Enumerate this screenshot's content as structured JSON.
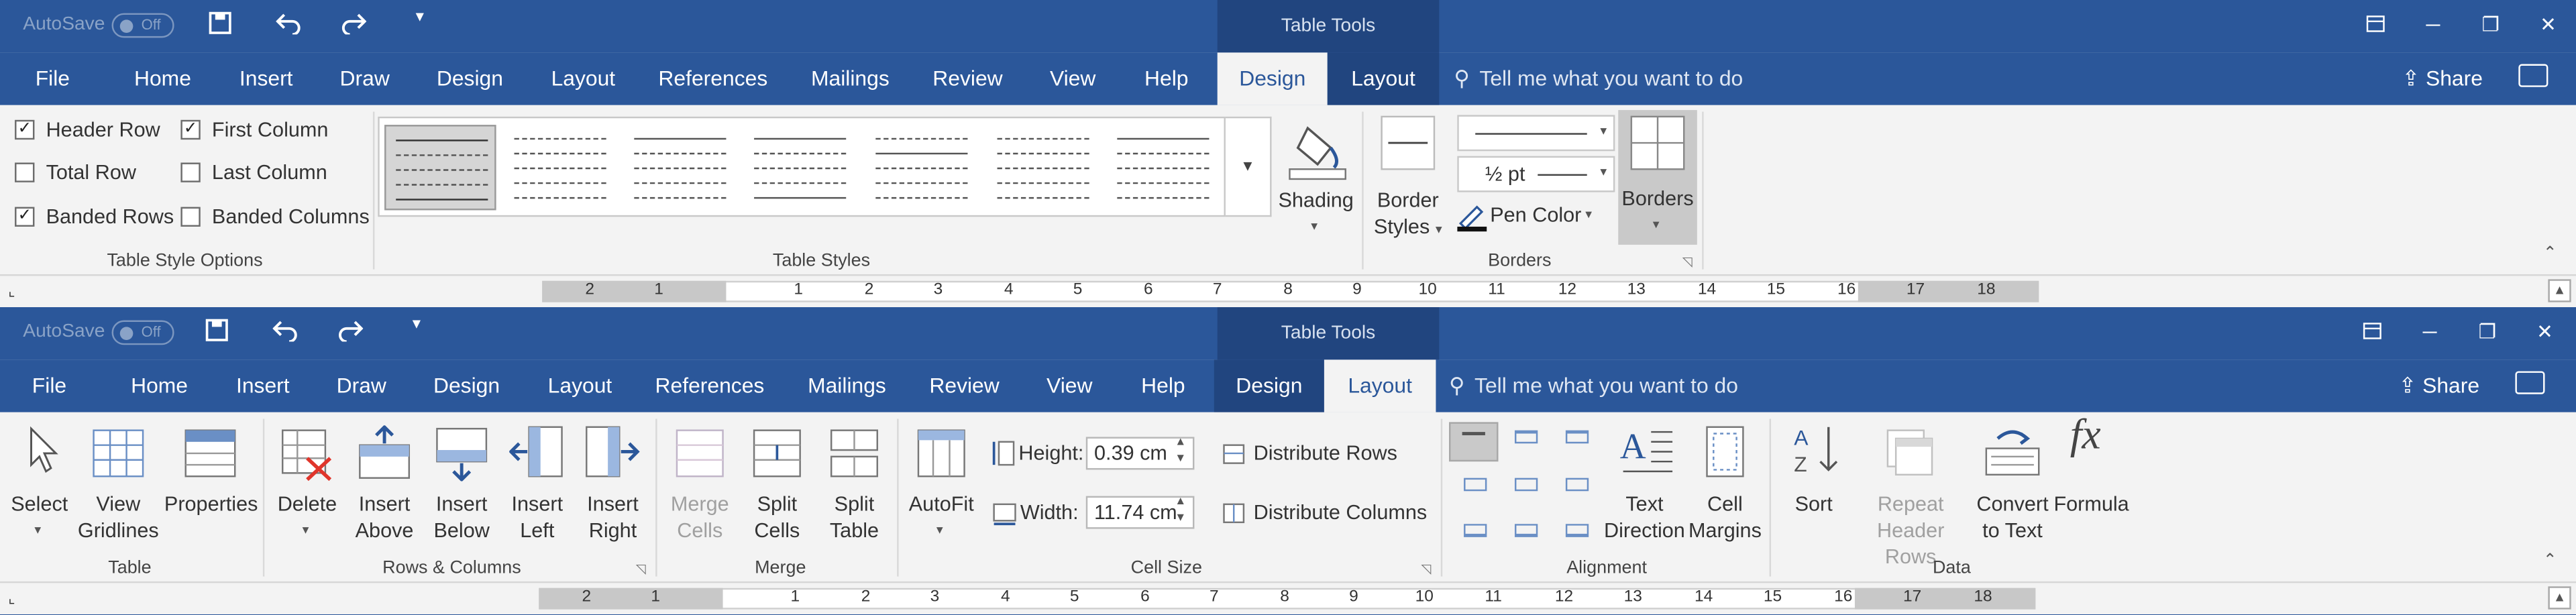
{
  "panel1": {
    "title": {
      "autosave": "AutoSave",
      "toggle": "Off",
      "context": "Table Tools"
    },
    "tabs": [
      "File",
      "Home",
      "Insert",
      "Draw",
      "Design",
      "Layout",
      "References",
      "Mailings",
      "Review",
      "View",
      "Help",
      "Design",
      "Layout"
    ],
    "active_tab": "Design",
    "tellme": "Tell me what you want to do",
    "share": "Share",
    "options": {
      "header_row": "Header Row",
      "first_column": "First Column",
      "total_row": "Total Row",
      "last_column": "Last Column",
      "banded_rows": "Banded Rows",
      "banded_columns": "Banded Columns",
      "checked": {
        "header_row": true,
        "first_column": true,
        "total_row": false,
        "last_column": false,
        "banded_rows": true,
        "banded_columns": false
      }
    },
    "groups": {
      "table_style_options": "Table Style Options",
      "table_styles": "Table Styles",
      "borders": "Borders"
    },
    "shading": "Shading",
    "border_styles_1": "Border",
    "border_styles_2": "Styles",
    "pen_weight": "½ pt",
    "pen_color": "Pen Color",
    "borders_btn": "Borders"
  },
  "panel2": {
    "title": {
      "autosave": "AutoSave",
      "toggle": "Off",
      "context": "Table Tools"
    },
    "tabs": [
      "File",
      "Home",
      "Insert",
      "Draw",
      "Design",
      "Layout",
      "References",
      "Mailings",
      "Review",
      "View",
      "Help",
      "Design",
      "Layout"
    ],
    "active_tab": "Layout",
    "tellme": "Tell me what you want to do",
    "share": "Share",
    "buttons": {
      "select": "Select",
      "view_1": "View",
      "view_2": "Gridlines",
      "properties": "Properties",
      "delete": "Delete",
      "ins_above_1": "Insert",
      "ins_above_2": "Above",
      "ins_below_1": "Insert",
      "ins_below_2": "Below",
      "ins_left_1": "Insert",
      "ins_left_2": "Left",
      "ins_right_1": "Insert",
      "ins_right_2": "Right",
      "merge_1": "Merge",
      "merge_2": "Cells",
      "split_cells_1": "Split",
      "split_cells_2": "Cells",
      "split_table_1": "Split",
      "split_table_2": "Table",
      "autofit": "AutoFit",
      "height_label": "Height:",
      "height_value": "0.39 cm",
      "width_label": "Width:",
      "width_value": "11.74 cm",
      "dist_rows": "Distribute Rows",
      "dist_cols": "Distribute Columns",
      "text_dir_1": "Text",
      "text_dir_2": "Direction",
      "cell_margins_1": "Cell",
      "cell_margins_2": "Margins",
      "sort": "Sort",
      "repeat_1": "Repeat",
      "repeat_2": "Header Rows",
      "convert_1": "Convert",
      "convert_2": "to Text",
      "formula": "Formula"
    },
    "groups": {
      "table": "Table",
      "rows_columns": "Rows & Columns",
      "merge": "Merge",
      "cell_size": "Cell Size",
      "alignment": "Alignment",
      "data": "Data"
    }
  },
  "ruler": {
    "left_nums": [
      "2",
      "1"
    ],
    "right_nums": [
      "1",
      "2",
      "3",
      "4",
      "5",
      "6",
      "7",
      "8",
      "9",
      "10",
      "11",
      "12",
      "13",
      "14",
      "15",
      "16",
      "17",
      "18"
    ]
  },
  "colors": {
    "brand": "#2b579a",
    "context": "#21457f",
    "ribbon": "#f3f3f3"
  }
}
